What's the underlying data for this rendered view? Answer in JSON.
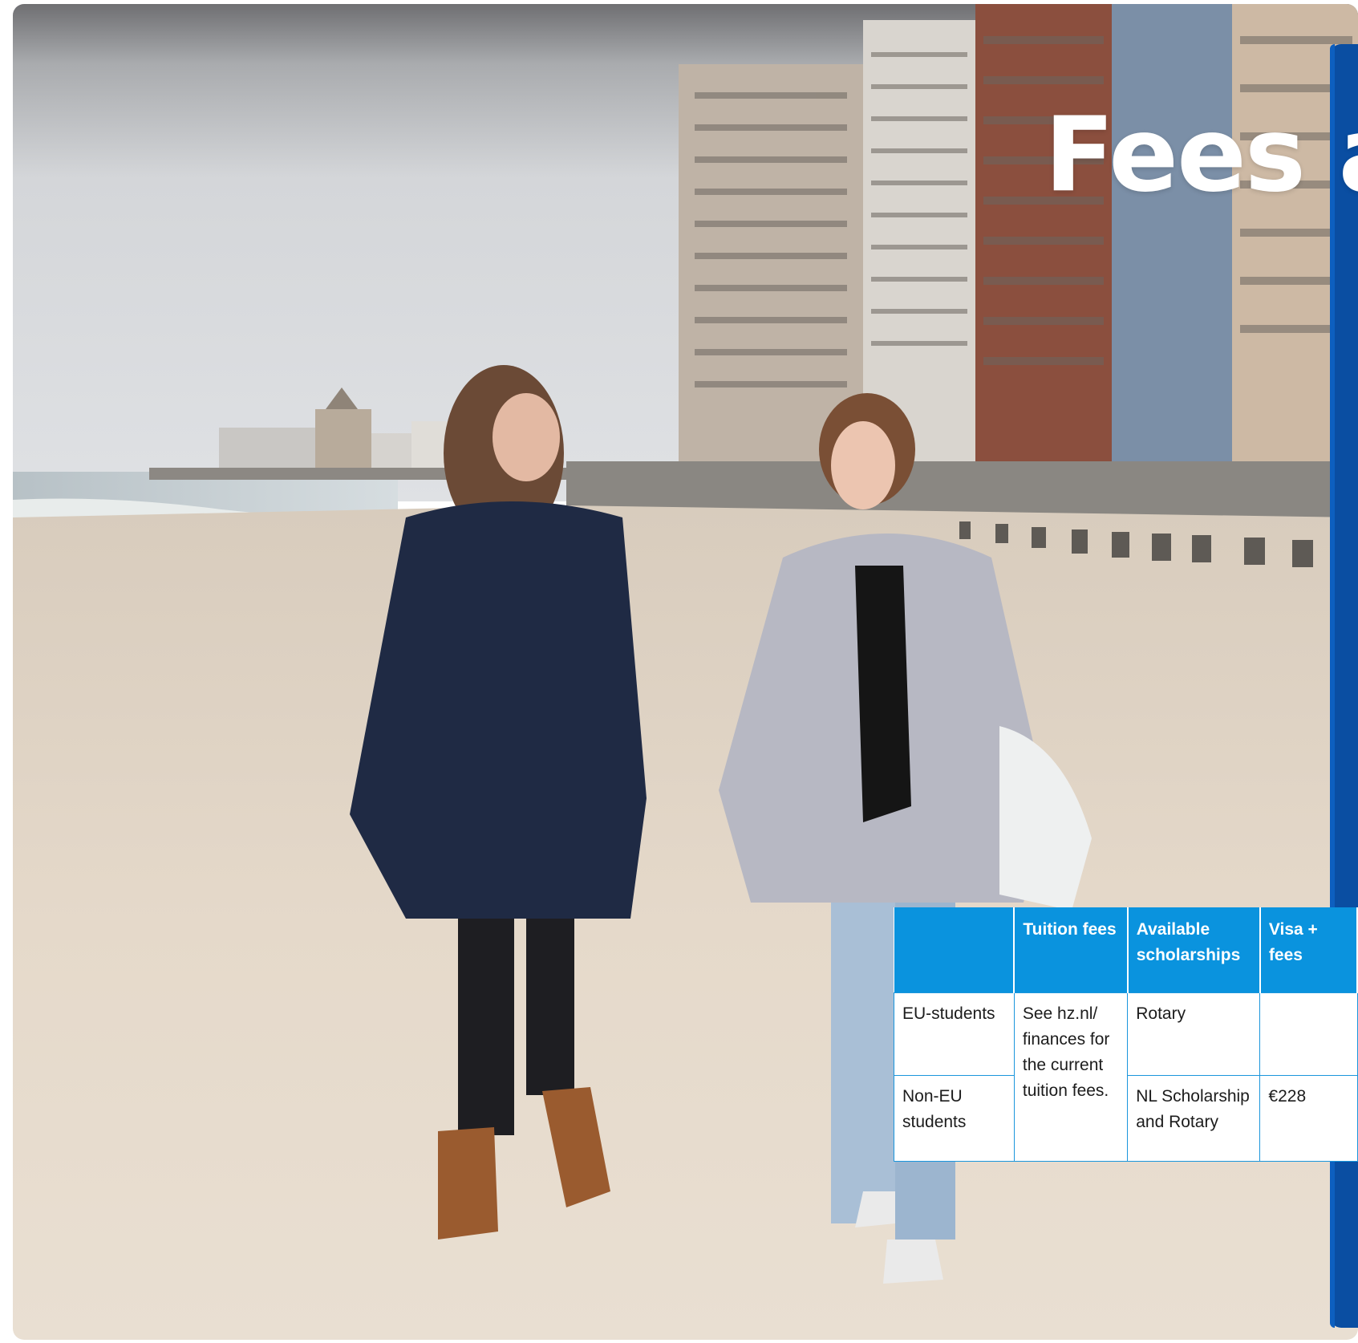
{
  "page": {
    "title": "Fees a"
  },
  "table": {
    "headers": [
      "",
      "Tuition fees",
      "Available scholarships",
      "Visa + fees"
    ],
    "rows": [
      {
        "group": "EU-students",
        "tuition": "See hz.nl/ finances for the current tuition fees.",
        "scholarships": "Rotary",
        "visa": ""
      },
      {
        "group": "Non-EU students",
        "scholarships": "NL Scholarship and Rotary",
        "visa": "€228"
      }
    ]
  },
  "colors": {
    "header_blue": "#0a93de",
    "panel_blue": "#0a4ea2",
    "border_blue": "#1b96dc"
  }
}
